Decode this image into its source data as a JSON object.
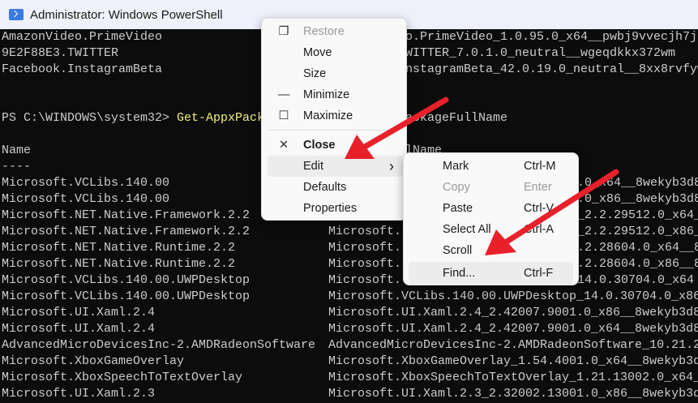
{
  "window": {
    "title": "Administrator: Windows PowerShell",
    "icon": "powershell-icon"
  },
  "terminal": {
    "top_lines": [
      {
        "left": "AmazonVideo.PrimeVideo",
        "right": "o.PrimeVideo_1.0.95.0_x64__pwbj9vvecjh7j"
      },
      {
        "left": "9E2F88E3.TWITTER",
        "right": "WITTER_7.0.1.0_neutral__wgeqdkkx372wm"
      },
      {
        "left": "Facebook.InstagramBeta",
        "right": "nstagramBeta_42.0.19.0_neutral__8xx8rvfyw"
      }
    ],
    "prompt": {
      "path": "PS C:\\WINDOWS\\system32> ",
      "command": "Get-AppxPack",
      "rest": "ackageFullName"
    },
    "header": {
      "col1": "Name",
      "col2_partial": "lName",
      "underline": "----"
    },
    "rows": [
      {
        "left": "Microsoft.VCLibs.140.00",
        "mid": "",
        "right": ".0_x64__8wekyb3d8"
      },
      {
        "left": "Microsoft.VCLibs.140.00",
        "mid": "",
        "right": ".0_x86__8wekyb3d8"
      },
      {
        "left": "Microsoft.NET.Native.Framework.2.2",
        "mid": "",
        "right": "_2.2.29512.0_x64_"
      },
      {
        "left": "Microsoft.NET.Native.Framework.2.2",
        "mid": "Microsoft.",
        "right": "_2.2.29512.0_x86_"
      },
      {
        "left": "Microsoft.NET.Native.Runtime.2.2",
        "mid": "Microsoft.",
        "right": ".2.28604.0_x64__8"
      },
      {
        "left": "Microsoft.NET.Native.Runtime.2.2",
        "mid": "Microsoft.",
        "right": ".2.28604.0_x86__8"
      },
      {
        "left": "Microsoft.VCLibs.140.00.UWPDesktop",
        "mid": "Microsoft.",
        "right": "14.0.30704.0_x64"
      },
      {
        "left": "Microsoft.VCLibs.140.00.UWPDesktop",
        "mid": "Microsoft.VCLibs.140.00.UWPDesktop_14.0.30704.0_x86",
        "right": ""
      },
      {
        "left": "Microsoft.UI.Xaml.2.4",
        "mid": "Microsoft.UI.Xaml.2.4_2.42007.9001.0_x86__8wekyb3d8",
        "right": ""
      },
      {
        "left": "Microsoft.UI.Xaml.2.4",
        "mid": "Microsoft.UI.Xaml.2.4_2.42007.9001.0_x64__8wekyb3d8",
        "right": ""
      },
      {
        "left": "AdvancedMicroDevicesInc-2.AMDRadeonSoftware",
        "mid": "AdvancedMicroDevicesInc-2.AMDRadeonSoftware_10.21.2",
        "right": ""
      },
      {
        "left": "Microsoft.XboxGameOverlay",
        "mid": "Microsoft.XboxGameOverlay_1.54.4001.0_x64__8wekyb3d",
        "right": ""
      },
      {
        "left": "Microsoft.XboxSpeechToTextOverlay",
        "mid": "Microsoft.XboxSpeechToTextOverlay_1.21.13002.0_x64_",
        "right": ""
      },
      {
        "left": "Microsoft.UI.Xaml.2.3",
        "mid": "Microsoft.UI.Xaml.2.3_2.32002.13001.0_x86__8wekyb3d8",
        "right": ""
      }
    ]
  },
  "system_menu": {
    "items": [
      {
        "label": "Restore",
        "icon": "restore-icon",
        "glyph": "❐",
        "disabled": true
      },
      {
        "label": "Move",
        "icon": "",
        "glyph": "",
        "disabled": false
      },
      {
        "label": "Size",
        "icon": "",
        "glyph": "",
        "disabled": false
      },
      {
        "label": "Minimize",
        "icon": "minimize-icon",
        "glyph": "—",
        "disabled": false
      },
      {
        "label": "Maximize",
        "icon": "maximize-icon",
        "glyph": "☐",
        "disabled": false
      },
      {
        "label": "Close",
        "icon": "close-icon",
        "glyph": "✕",
        "disabled": false
      },
      {
        "label": "Edit",
        "submenu_glyph": "›",
        "highlighted": true
      },
      {
        "label": "Defaults"
      },
      {
        "label": "Properties"
      }
    ]
  },
  "edit_submenu": {
    "items": [
      {
        "label": "Mark",
        "shortcut": "Ctrl-M"
      },
      {
        "label": "Copy",
        "shortcut": "Enter",
        "disabled": true
      },
      {
        "label": "Paste",
        "shortcut": "Ctrl-V"
      },
      {
        "label": "Select All",
        "shortcut": "Ctrl-A"
      },
      {
        "label": "Scroll",
        "shortcut": ""
      },
      {
        "label": "Find...",
        "shortcut": "Ctrl-F",
        "highlighted": true
      }
    ]
  },
  "colors": {
    "terminal_bg": "#0c0c0c",
    "terminal_fg": "#cccccc",
    "command": "#f1f17a",
    "arrow": "#e8202a",
    "menu_bg": "#f9f9f9"
  }
}
